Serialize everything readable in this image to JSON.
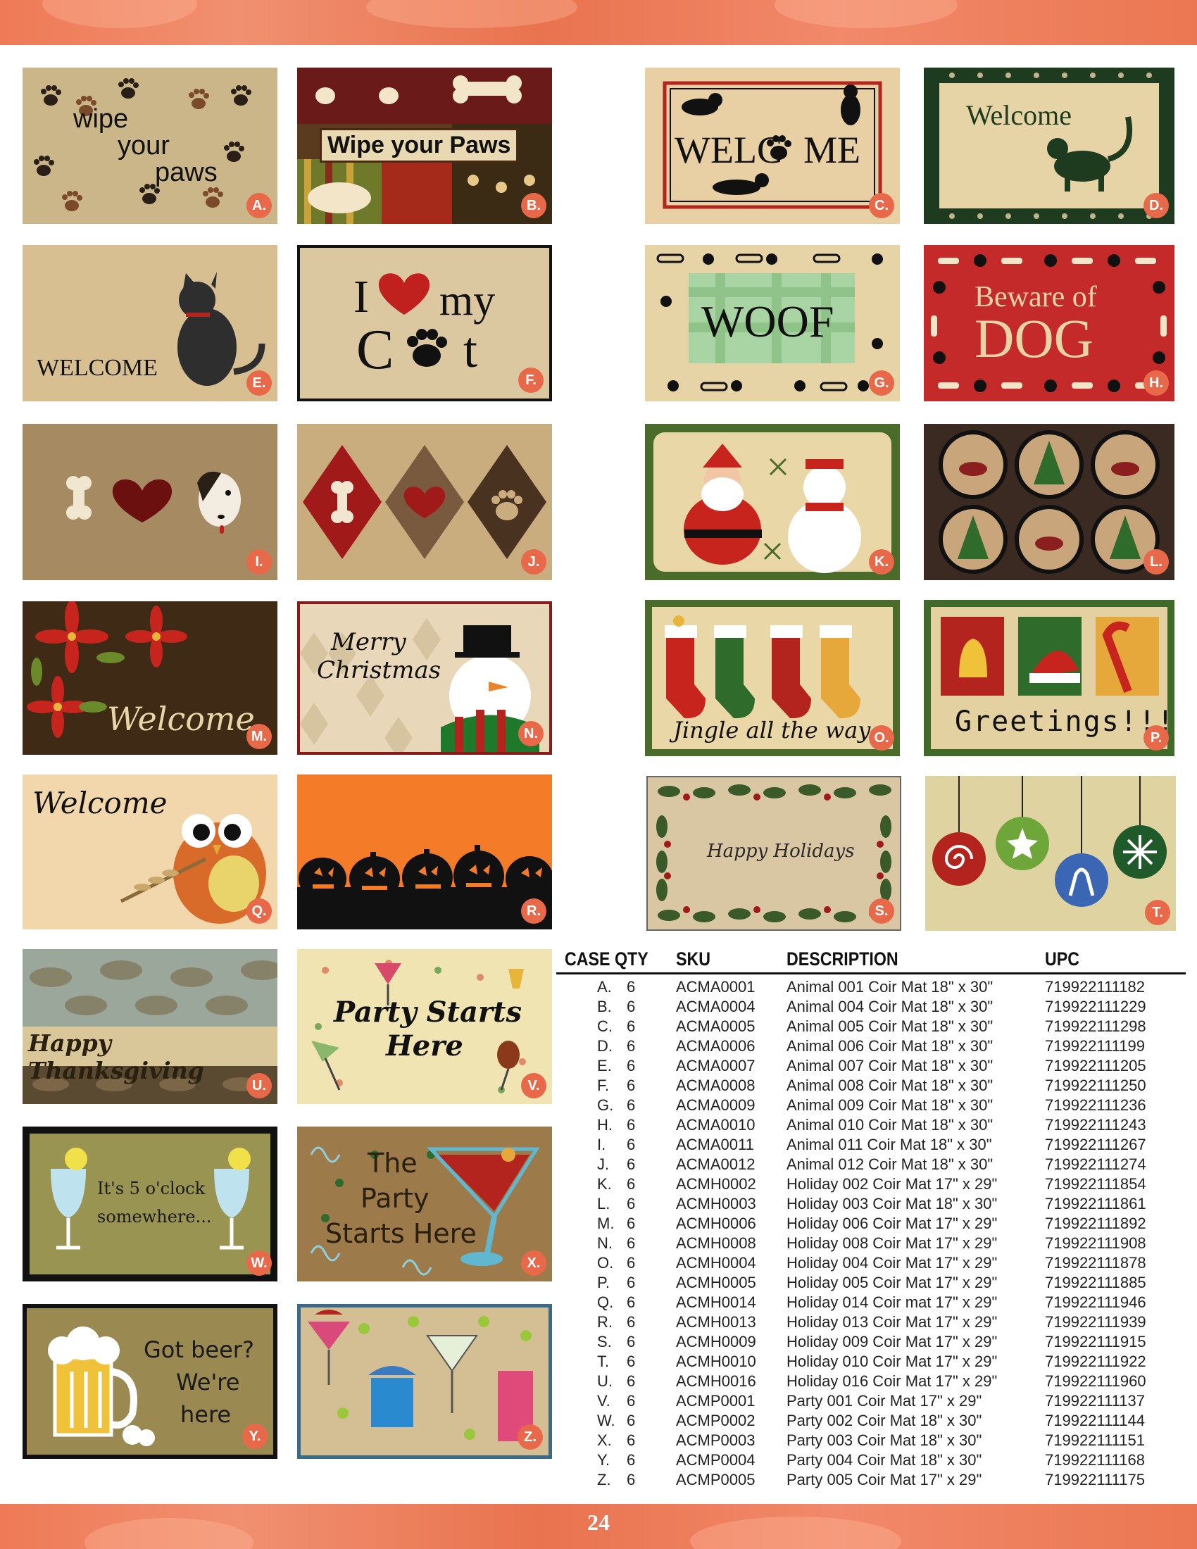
{
  "page_number": "24",
  "mats": [
    {
      "letter": "A.",
      "text": [
        "wipe",
        "your",
        "paws"
      ]
    },
    {
      "letter": "B.",
      "text": [
        "Wipe your Paws"
      ]
    },
    {
      "letter": "C.",
      "text": [
        "WELC",
        "ME"
      ]
    },
    {
      "letter": "D.",
      "text": [
        "Welcome"
      ]
    },
    {
      "letter": "E.",
      "text": [
        "WELCOME"
      ]
    },
    {
      "letter": "F.",
      "text": [
        "I",
        "my",
        "C",
        "t"
      ]
    },
    {
      "letter": "G.",
      "text": [
        "WOOF"
      ]
    },
    {
      "letter": "H.",
      "text": [
        "Beware of",
        "DOG"
      ]
    },
    {
      "letter": "I.",
      "text": []
    },
    {
      "letter": "J.",
      "text": []
    },
    {
      "letter": "K.",
      "text": []
    },
    {
      "letter": "L.",
      "text": []
    },
    {
      "letter": "M.",
      "text": [
        "Welcome"
      ]
    },
    {
      "letter": "N.",
      "text": [
        "Merry",
        "Christmas"
      ]
    },
    {
      "letter": "O.",
      "text": [
        "Jingle all the way"
      ]
    },
    {
      "letter": "P.",
      "text": [
        "Greetings!!!"
      ]
    },
    {
      "letter": "Q.",
      "text": [
        "Welcome"
      ]
    },
    {
      "letter": "R.",
      "text": []
    },
    {
      "letter": "S.",
      "text": [
        "Happy Holidays"
      ]
    },
    {
      "letter": "T.",
      "text": []
    },
    {
      "letter": "U.",
      "text": [
        "Happy Thanksgiving"
      ]
    },
    {
      "letter": "V.",
      "text": [
        "Party Starts",
        "Here"
      ]
    },
    {
      "letter": "W.",
      "text": [
        "It's 5 o'clock",
        "somewhere..."
      ]
    },
    {
      "letter": "X.",
      "text": [
        "The",
        "Party",
        "Starts Here"
      ]
    },
    {
      "letter": "Y.",
      "text": [
        "Got beer?",
        "We're",
        "here"
      ]
    },
    {
      "letter": "Z.",
      "text": []
    }
  ],
  "table": {
    "headers": [
      "CASE QTY",
      "SKU",
      "DESCRIPTION",
      "UPC"
    ],
    "rows": [
      [
        "A.",
        "6",
        "ACMA0001",
        "Animal 001 Coir Mat 18\" x 30\"",
        "719922111182"
      ],
      [
        "B.",
        "6",
        "ACMA0004",
        "Animal 004 Coir Mat 18\" x 30\"",
        "719922111229"
      ],
      [
        "C.",
        "6",
        "ACMA0005",
        "Animal 005 Coir Mat 18\" x 30\"",
        "719922111298"
      ],
      [
        "D.",
        "6",
        "ACMA0006",
        "Animal 006 Coir Mat 18\" x 30\"",
        "719922111199"
      ],
      [
        "E.",
        "6",
        "ACMA0007",
        "Animal 007 Coir Mat 18\" x 30\"",
        "719922111205"
      ],
      [
        "F.",
        "6",
        "ACMA0008",
        "Animal 008 Coir Mat 18\" x 30\"",
        "719922111250"
      ],
      [
        "G.",
        "6",
        "ACMA0009",
        "Animal 009 Coir Mat 18\" x 30\"",
        "719922111236"
      ],
      [
        "H.",
        "6",
        "ACMA0010",
        "Animal 010 Coir Mat 18\" x 30\"",
        "719922111243"
      ],
      [
        "I.",
        "6",
        "ACMA0011",
        "Animal 011 Coir Mat 18\" x 30\"",
        "719922111267"
      ],
      [
        "J.",
        "6",
        "ACMA0012",
        "Animal 012 Coir Mat 18\" x 30\"",
        "719922111274"
      ],
      [
        "K.",
        "6",
        "ACMH0002",
        "Holiday 002 Coir Mat 17\" x 29\"",
        "719922111854"
      ],
      [
        "L.",
        "6",
        "ACMH0003",
        "Holiday 003 Coir Mat 18\" x 30\"",
        "719922111861"
      ],
      [
        "M.",
        "6",
        "ACMH0006",
        "Holiday 006 Coir Mat 17\" x 29\"",
        "719922111892"
      ],
      [
        "N.",
        "6",
        "ACMH0008",
        "Holiday 008 Coir Mat 17\" x 29\"",
        "719922111908"
      ],
      [
        "O.",
        "6",
        "ACMH0004",
        "Holiday 004 Coir Mat 17\" x 29\"",
        "719922111878"
      ],
      [
        "P.",
        "6",
        "ACMH0005",
        "Holiday 005 Coir Mat 17\" x 29\"",
        "719922111885"
      ],
      [
        "Q.",
        "6",
        "ACMH0014",
        "Holiday 014 Coir mat 17\" x 29\"",
        "719922111946"
      ],
      [
        "R.",
        "6",
        "ACMH0013",
        "Holiday 013 Coir Mat 17\" x 29\"",
        "719922111939"
      ],
      [
        "S.",
        "6",
        "ACMH0009",
        "Holiday 009 Coir Mat 17\" x 29\"",
        "719922111915"
      ],
      [
        "T.",
        "6",
        "ACMH0010",
        "Holiday 010 Coir Mat 17\" x 29\"",
        "719922111922"
      ],
      [
        "U.",
        "6",
        "ACMH0016",
        "Holiday 016 Coir Mat 17\" x 29\"",
        "719922111960"
      ],
      [
        "V.",
        "6",
        "ACMP0001",
        "Party 001 Coir Mat 17\" x 29\"",
        "719922111137"
      ],
      [
        "W.",
        "6",
        "ACMP0002",
        "Party 002 Coir Mat 18\" x 30\"",
        "719922111144"
      ],
      [
        "X.",
        "6",
        "ACMP0003",
        "Party 003 Coir Mat 18\" x 30\"",
        "719922111151"
      ],
      [
        "Y.",
        "6",
        "ACMP0004",
        "Party 004 Coir Mat 18\" x 30\"",
        "719922111168"
      ],
      [
        "Z.",
        "6",
        "ACMP0005",
        "Party 005 Coir Mat 17\" x 29\"",
        "719922111175"
      ]
    ]
  }
}
